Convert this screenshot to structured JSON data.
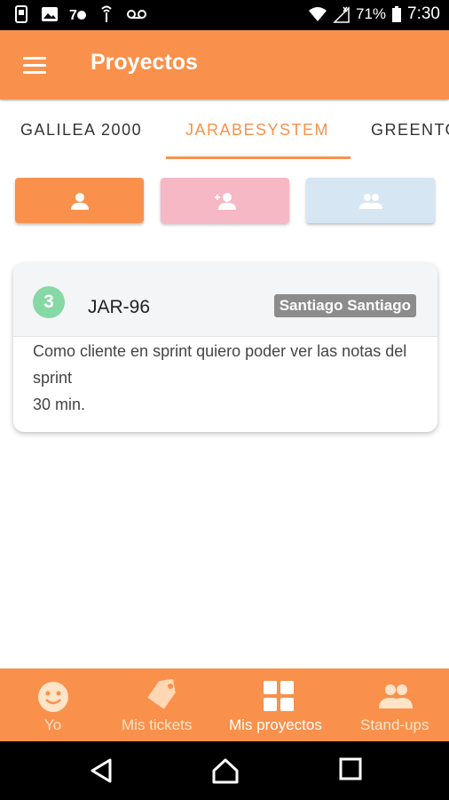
{
  "statusbar": {
    "battery": "71%",
    "time": "7:30"
  },
  "appbar": {
    "title": "Proyectos"
  },
  "tabs": [
    {
      "label": "GALILEA 2000"
    },
    {
      "label": "JARABESYSTEM"
    },
    {
      "label": "GREENTO"
    }
  ],
  "filters": [
    {
      "icon": "person-icon",
      "color": "#F9914C"
    },
    {
      "icon": "person-add-icon",
      "color": "#F5B8C4"
    },
    {
      "icon": "people-icon",
      "color": "#D6E6F2"
    }
  ],
  "ticket": {
    "points": "3",
    "id": "JAR-96",
    "assignee": "Santiago Santiago",
    "description": "Como cliente en sprint quiero poder ver las notas del sprint",
    "time": "30 min."
  },
  "bottom_nav": [
    {
      "label": "Yo",
      "icon": "smiley-icon"
    },
    {
      "label": "Mis tickets",
      "icon": "tag-icon"
    },
    {
      "label": "Mis proyectos",
      "icon": "grid-icon"
    },
    {
      "label": "Stand-ups",
      "icon": "people-icon"
    }
  ],
  "colors": {
    "primary": "#F9914C",
    "points_badge": "#86D8A4",
    "assignee_badge": "#8C8C8C"
  }
}
